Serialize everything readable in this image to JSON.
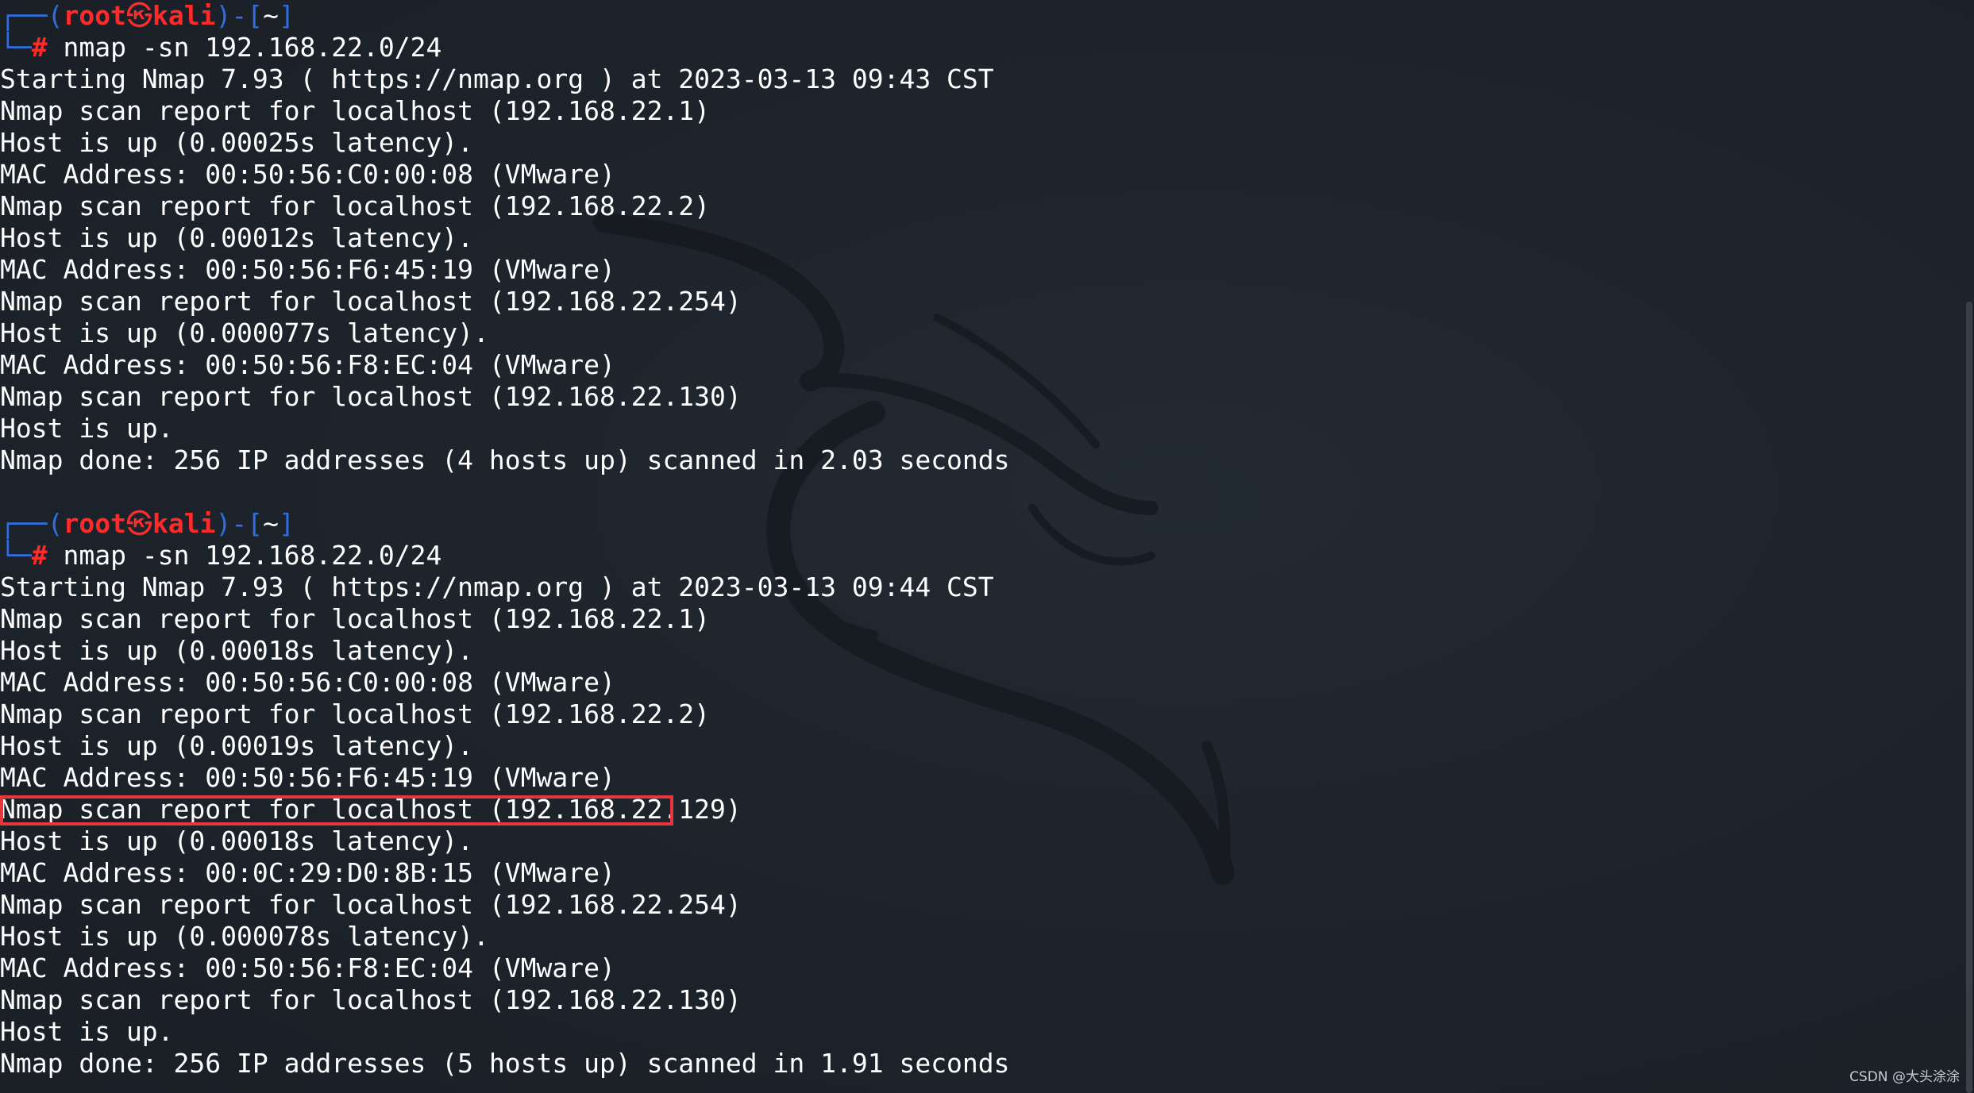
{
  "colors": {
    "background": "#1d2229",
    "prompt_frame": "#2f6fe0",
    "prompt_user": "#ff2a2a",
    "text": "#ffffff",
    "highlight_box": "#e8363d"
  },
  "prompt": {
    "open_paren": "(",
    "user": "root",
    "separator_icon": "kali-skull-icon",
    "separator_glyph": "㉿",
    "host": "kali",
    "close_paren": ")",
    "dash": "-",
    "dir_open": "[",
    "dir": "~",
    "dir_close": "]",
    "symbol": "#"
  },
  "sessions": [
    {
      "command": "nmap -sn 192.168.22.0/24",
      "output": [
        "Starting Nmap 7.93 ( https://nmap.org ) at 2023-03-13 09:43 CST",
        "Nmap scan report for localhost (192.168.22.1)",
        "Host is up (0.00025s latency).",
        "MAC Address: 00:50:56:C0:00:08 (VMware)",
        "Nmap scan report for localhost (192.168.22.2)",
        "Host is up (0.00012s latency).",
        "MAC Address: 00:50:56:F6:45:19 (VMware)",
        "Nmap scan report for localhost (192.168.22.254)",
        "Host is up (0.000077s latency).",
        "MAC Address: 00:50:56:F8:EC:04 (VMware)",
        "Nmap scan report for localhost (192.168.22.130)",
        "Host is up.",
        "Nmap done: 256 IP addresses (4 hosts up) scanned in 2.03 seconds"
      ]
    },
    {
      "command": "nmap -sn 192.168.22.0/24",
      "output": [
        "Starting Nmap 7.93 ( https://nmap.org ) at 2023-03-13 09:44 CST",
        "Nmap scan report for localhost (192.168.22.1)",
        "Host is up (0.00018s latency).",
        "MAC Address: 00:50:56:C0:00:08 (VMware)",
        "Nmap scan report for localhost (192.168.22.2)",
        "Host is up (0.00019s latency).",
        "MAC Address: 00:50:56:F6:45:19 (VMware)",
        "Nmap scan report for localhost (192.168.22.129)",
        "Host is up (0.00018s latency).",
        "MAC Address: 00:0C:29:D0:8B:15 (VMware)",
        "Nmap scan report for localhost (192.168.22.254)",
        "Host is up (0.000078s latency).",
        "MAC Address: 00:50:56:F8:EC:04 (VMware)",
        "Nmap scan report for localhost (192.168.22.130)",
        "Host is up.",
        "Nmap done: 256 IP addresses (5 hosts up) scanned in 1.91 seconds"
      ]
    }
  ],
  "watermark": {
    "icon": "kali-dragon-icon"
  },
  "credit": "CSDN @大头涂涂"
}
